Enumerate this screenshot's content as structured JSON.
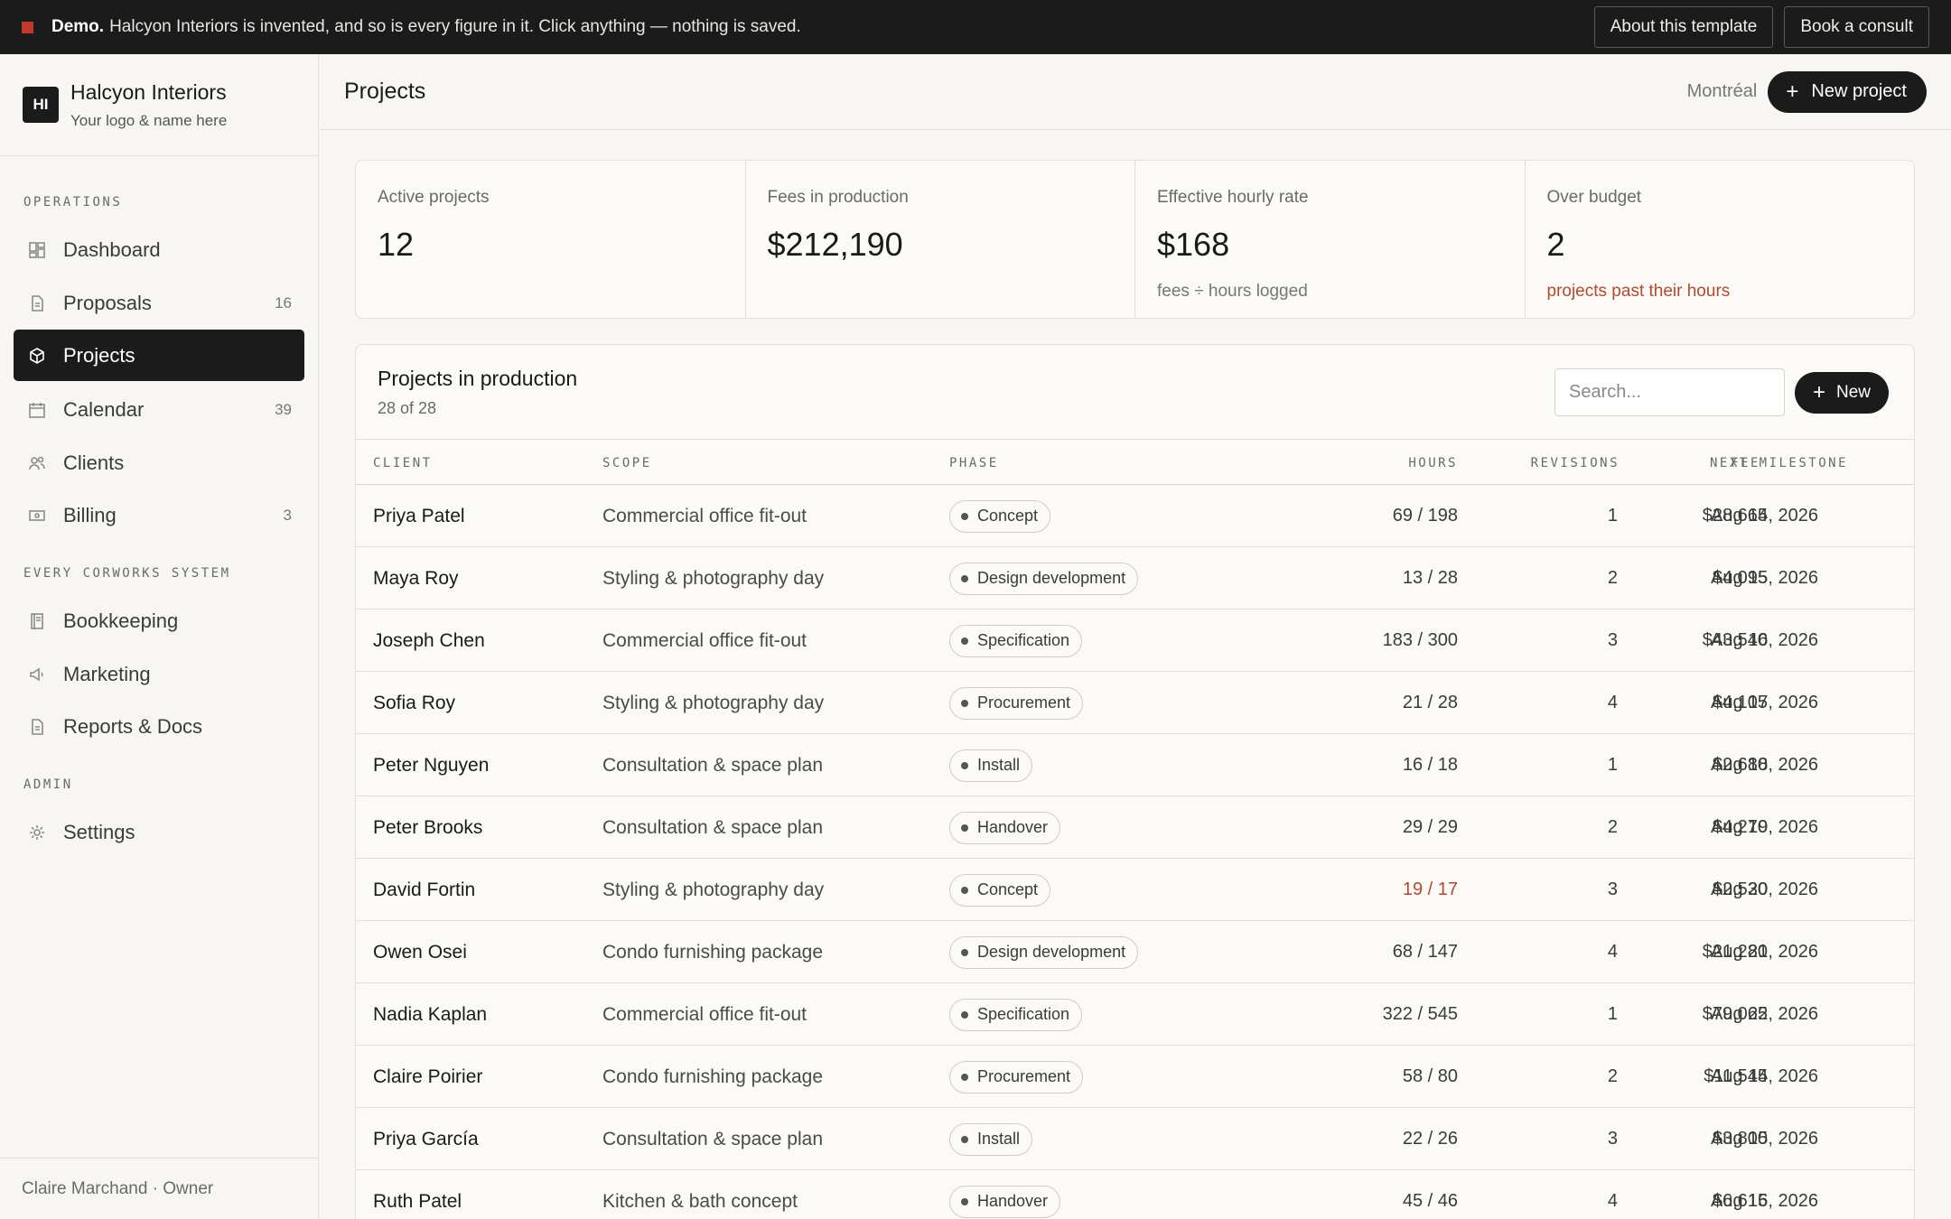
{
  "banner": {
    "demo_label": "Demo.",
    "message": "Halcyon Interiors is invented, and so is every figure in it. Click anything — nothing is saved.",
    "about_label": "About this template",
    "consult_label": "Book a consult",
    "accent_color": "#c0392b"
  },
  "brand": {
    "logo_text": "HI",
    "name": "Halcyon Interiors",
    "subtitle": "Your logo & name here"
  },
  "sidebar": {
    "sections": [
      {
        "label": "OPERATIONS",
        "items": [
          {
            "label": "Dashboard",
            "icon": "dashboard-icon",
            "count": ""
          },
          {
            "label": "Proposals",
            "icon": "document-icon",
            "count": "16"
          },
          {
            "label": "Projects",
            "icon": "cube-icon",
            "count": "",
            "active": true
          },
          {
            "label": "Calendar",
            "icon": "calendar-icon",
            "count": "39"
          },
          {
            "label": "Clients",
            "icon": "users-icon",
            "count": ""
          },
          {
            "label": "Billing",
            "icon": "billing-icon",
            "count": "3"
          }
        ]
      },
      {
        "label": "EVERY CORWORKS SYSTEM",
        "items": [
          {
            "label": "Bookkeeping",
            "icon": "ledger-icon",
            "count": ""
          },
          {
            "label": "Marketing",
            "icon": "megaphone-icon",
            "count": ""
          },
          {
            "label": "Reports & Docs",
            "icon": "document-icon",
            "count": ""
          }
        ]
      },
      {
        "label": "ADMIN",
        "items": [
          {
            "label": "Settings",
            "icon": "gear-icon",
            "count": ""
          }
        ]
      }
    ],
    "footer": "Claire Marchand · Owner"
  },
  "header": {
    "title": "Projects",
    "location": "Montréal",
    "new_project_label": "New project"
  },
  "stats": [
    {
      "label": "Active projects",
      "value": "12",
      "sub": ""
    },
    {
      "label": "Fees in production",
      "value": "$212,190",
      "sub": ""
    },
    {
      "label": "Effective hourly rate",
      "value": "$168",
      "sub": "fees ÷ hours logged"
    },
    {
      "label": "Over budget",
      "value": "2",
      "sub": "projects past their hours",
      "warn": true
    }
  ],
  "table": {
    "title": "Projects in production",
    "subtitle": "28 of 28",
    "search_placeholder": "Search...",
    "new_label": "New",
    "columns": {
      "client": "CLIENT",
      "scope": "SCOPE",
      "phase": "PHASE",
      "hours": "HOURS",
      "revisions": "REVISIONS",
      "fee": "FEE",
      "milestone": "NEXT MILESTONE"
    },
    "rows": [
      {
        "client": "Priya Patel",
        "scope": "Commercial office fit-out",
        "phase": "Concept",
        "hours": "69 / 198",
        "revisions": "1",
        "fee": "$28,665",
        "milestone": "Aug 14, 2026"
      },
      {
        "client": "Maya Roy",
        "scope": "Styling & photography day",
        "phase": "Design development",
        "hours": "13 / 28",
        "revisions": "2",
        "fee": "$4,095",
        "milestone": "Aug 15, 2026"
      },
      {
        "client": "Joseph Chen",
        "scope": "Commercial office fit-out",
        "phase": "Specification",
        "hours": "183 / 300",
        "revisions": "3",
        "fee": "$43,540",
        "milestone": "Aug 16, 2026"
      },
      {
        "client": "Sofia Roy",
        "scope": "Styling & photography day",
        "phase": "Procurement",
        "hours": "21 / 28",
        "revisions": "4",
        "fee": "$4,105",
        "milestone": "Aug 17, 2026"
      },
      {
        "client": "Peter Nguyen",
        "scope": "Consultation & space plan",
        "phase": "Install",
        "hours": "16 / 18",
        "revisions": "1",
        "fee": "$2,680",
        "milestone": "Aug 18, 2026"
      },
      {
        "client": "Peter Brooks",
        "scope": "Consultation & space plan",
        "phase": "Handover",
        "hours": "29 / 29",
        "revisions": "2",
        "fee": "$4,270",
        "milestone": "Aug 19, 2026"
      },
      {
        "client": "David Fortin",
        "scope": "Styling & photography day",
        "phase": "Concept",
        "hours": "19 / 17",
        "over": true,
        "revisions": "3",
        "fee": "$2,530",
        "milestone": "Aug 20, 2026"
      },
      {
        "client": "Owen Osei",
        "scope": "Condo furnishing package",
        "phase": "Design development",
        "hours": "68 / 147",
        "revisions": "4",
        "fee": "$21,280",
        "milestone": "Aug 21, 2026"
      },
      {
        "client": "Nadia Kaplan",
        "scope": "Commercial office fit-out",
        "phase": "Specification",
        "hours": "322 / 545",
        "revisions": "1",
        "fee": "$79,065",
        "milestone": "Aug 22, 2026"
      },
      {
        "client": "Claire Poirier",
        "scope": "Condo furnishing package",
        "phase": "Procurement",
        "hours": "58 / 80",
        "revisions": "2",
        "fee": "$11,545",
        "milestone": "Aug 14, 2026"
      },
      {
        "client": "Priya García",
        "scope": "Consultation & space plan",
        "phase": "Install",
        "hours": "22 / 26",
        "revisions": "3",
        "fee": "$3,800",
        "milestone": "Aug 15, 2026"
      },
      {
        "client": "Ruth Patel",
        "scope": "Kitchen & bath concept",
        "phase": "Handover",
        "hours": "45 / 46",
        "revisions": "4",
        "fee": "$6,615",
        "milestone": "Aug 16, 2026"
      }
    ]
  }
}
